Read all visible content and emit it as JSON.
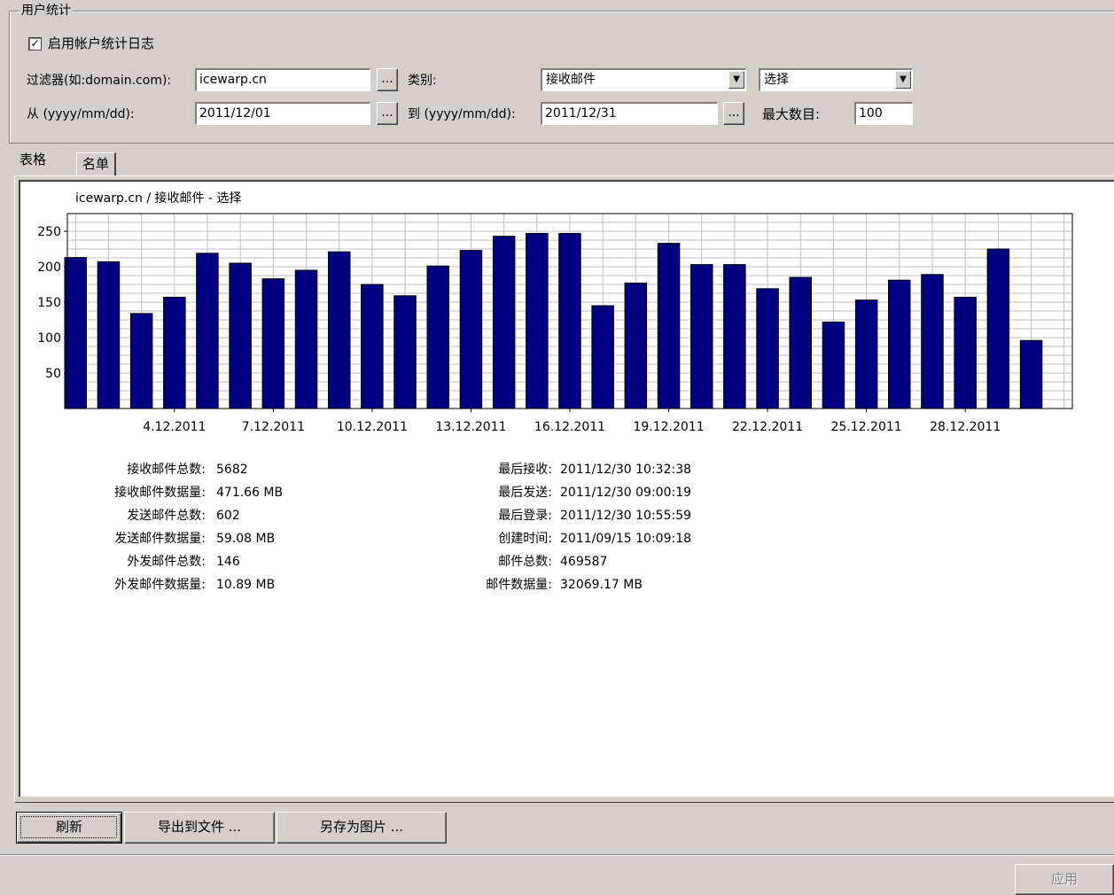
{
  "group": {
    "title": "用户统计",
    "enable_log_label": "启用帐户统计日志",
    "enable_log_checked": true,
    "filter_label": "过滤器(如:domain.com):",
    "filter_value": "icewarp.cn",
    "category_label": "类别:",
    "category_value": "接收邮件",
    "select_value": "选择",
    "from_label": "从 (yyyy/mm/dd):",
    "from_value": "2011/12/01",
    "to_label": "到 (yyyy/mm/dd):",
    "to_value": "2011/12/31",
    "max_label": "最大数目:",
    "max_value": "100",
    "ellipsis": "..."
  },
  "tabs": [
    {
      "label": "表格"
    },
    {
      "label": "名单"
    }
  ],
  "chart_data": {
    "type": "bar",
    "title": "icewarp.cn / 接收邮件 - 选择",
    "x": [
      "1.12.2011",
      "2.12.2011",
      "3.12.2011",
      "4.12.2011",
      "5.12.2011",
      "6.12.2011",
      "7.12.2011",
      "8.12.2011",
      "9.12.2011",
      "10.12.2011",
      "11.12.2011",
      "12.12.2011",
      "13.12.2011",
      "14.12.2011",
      "15.12.2011",
      "16.12.2011",
      "17.12.2011",
      "18.12.2011",
      "19.12.2011",
      "20.12.2011",
      "21.12.2011",
      "22.12.2011",
      "23.12.2011",
      "24.12.2011",
      "25.12.2011",
      "26.12.2011",
      "27.12.2011",
      "28.12.2011",
      "29.12.2011",
      "30.12.2011"
    ],
    "values": [
      213,
      207,
      134,
      157,
      219,
      205,
      183,
      195,
      221,
      175,
      159,
      201,
      223,
      243,
      247,
      247,
      145,
      177,
      233,
      203,
      203,
      169,
      185,
      122,
      153,
      181,
      189,
      157,
      225,
      96
    ],
    "x_tick_labels": [
      "4.12.2011",
      "7.12.2011",
      "10.12.2011",
      "13.12.2011",
      "16.12.2011",
      "19.12.2011",
      "22.12.2011",
      "25.12.2011",
      "28.12.2011"
    ],
    "y_ticks": [
      50,
      100,
      150,
      200,
      250
    ],
    "ylim": [
      0,
      275
    ],
    "bar_color": "#000080",
    "grid": true
  },
  "stats_left": [
    {
      "label": "接收邮件总数:",
      "value": "5682"
    },
    {
      "label": "接收邮件数据量:",
      "value": "471.66 MB"
    },
    {
      "label": "发送邮件总数:",
      "value": "602"
    },
    {
      "label": "发送邮件数据量:",
      "value": "59.08 MB"
    },
    {
      "label": "外发邮件总数:",
      "value": "146"
    },
    {
      "label": "外发邮件数据量:",
      "value": "10.89 MB"
    }
  ],
  "stats_right": [
    {
      "label": "最后接收:",
      "value": "2011/12/30 10:32:38"
    },
    {
      "label": "最后发送:",
      "value": "2011/12/30 09:00:19"
    },
    {
      "label": "最后登录:",
      "value": "2011/12/30 10:55:59"
    },
    {
      "label": "创建时间:",
      "value": "2011/09/15 10:09:18"
    },
    {
      "label": "邮件总数:",
      "value": "469587"
    },
    {
      "label": "邮件数据量:",
      "value": "32069.17 MB"
    }
  ],
  "buttons": {
    "refresh": "刷新",
    "export": "导出到文件 ...",
    "save_image": "另存为图片 ...",
    "apply": "应用"
  }
}
